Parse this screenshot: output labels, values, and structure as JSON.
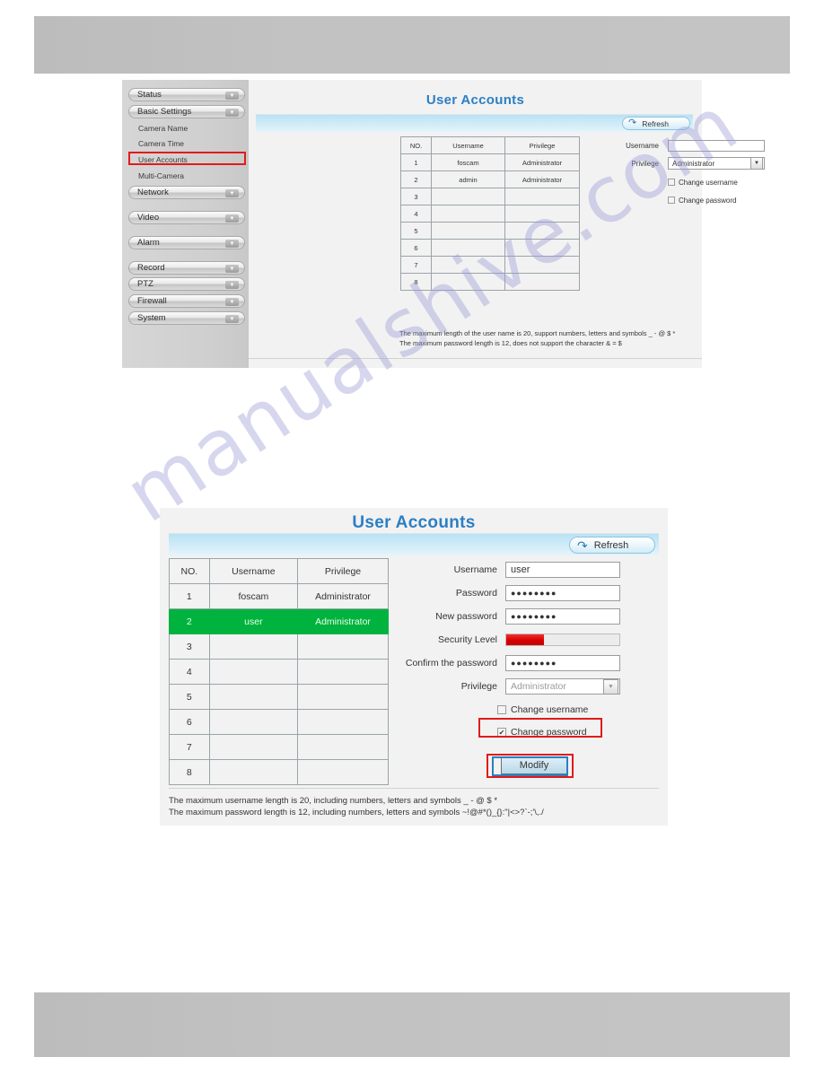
{
  "watermark": {
    "text": "manualshive.com"
  },
  "panel1": {
    "title": "User Accounts",
    "refresh_label": "Refresh",
    "refresh_icon": "refresh-arrow-icon",
    "sidebar": {
      "groups": [
        {
          "label": "Status",
          "icon": "chevron-down-icon"
        },
        {
          "label": "Basic Settings",
          "icon": "chevron-down-icon"
        },
        {
          "label": "Network",
          "icon": "chevron-down-icon"
        },
        {
          "label": "Video",
          "icon": "chevron-down-icon"
        },
        {
          "label": "Alarm",
          "icon": "chevron-down-icon"
        },
        {
          "label": "Record",
          "icon": "chevron-down-icon"
        },
        {
          "label": "PTZ",
          "icon": "chevron-down-icon"
        },
        {
          "label": "Firewall",
          "icon": "chevron-down-icon"
        },
        {
          "label": "System",
          "icon": "chevron-down-icon"
        }
      ],
      "sub_items": [
        {
          "label": "Camera Name"
        },
        {
          "label": "Camera Time"
        },
        {
          "label": "User Accounts"
        },
        {
          "label": "Multi-Camera"
        }
      ]
    },
    "table": {
      "headers": [
        "NO.",
        "Username",
        "Privilege"
      ],
      "rows": [
        {
          "no": "1",
          "username": "foscam",
          "privilege": "Administrator"
        },
        {
          "no": "2",
          "username": "admin",
          "privilege": "Administrator"
        },
        {
          "no": "3",
          "username": "",
          "privilege": ""
        },
        {
          "no": "4",
          "username": "",
          "privilege": ""
        },
        {
          "no": "5",
          "username": "",
          "privilege": ""
        },
        {
          "no": "6",
          "username": "",
          "privilege": ""
        },
        {
          "no": "7",
          "username": "",
          "privilege": ""
        },
        {
          "no": "8",
          "username": "",
          "privilege": ""
        }
      ]
    },
    "form": {
      "username_label": "Username",
      "username_value": "",
      "privilege_label": "Privilege",
      "privilege_value": "Administrator",
      "change_username_label": "Change username",
      "change_username_checked": false,
      "change_password_label": "Change password",
      "change_password_checked": false
    },
    "hints": [
      "The maximum length of the user name is 20, support numbers, letters and symbols _ - @ $ *",
      "The maximum password length is 12, does not support the character & = $"
    ]
  },
  "panel2": {
    "title": "User Accounts",
    "refresh_label": "Refresh",
    "refresh_icon": "refresh-arrow-icon",
    "table": {
      "headers": [
        "NO.",
        "Username",
        "Privilege"
      ],
      "rows": [
        {
          "no": "1",
          "username": "foscam",
          "privilege": "Administrator",
          "selected": false
        },
        {
          "no": "2",
          "username": "user",
          "privilege": "Administrator",
          "selected": true
        },
        {
          "no": "3",
          "username": "",
          "privilege": "",
          "selected": false
        },
        {
          "no": "4",
          "username": "",
          "privilege": "",
          "selected": false
        },
        {
          "no": "5",
          "username": "",
          "privilege": "",
          "selected": false
        },
        {
          "no": "6",
          "username": "",
          "privilege": "",
          "selected": false
        },
        {
          "no": "7",
          "username": "",
          "privilege": "",
          "selected": false
        },
        {
          "no": "8",
          "username": "",
          "privilege": "",
          "selected": false
        }
      ]
    },
    "form": {
      "username_label": "Username",
      "username_value": "user",
      "password_label": "Password",
      "password_value": "●●●●●●●●",
      "new_password_label": "New password",
      "new_password_value": "●●●●●●●●",
      "security_level_label": "Security Level",
      "security_level_percent": 33,
      "security_level_color": "#d80000",
      "confirm_password_label": "Confirm the password",
      "confirm_password_value": "●●●●●●●●",
      "privilege_label": "Privilege",
      "privilege_value": "Administrator",
      "change_username_label": "Change username",
      "change_username_checked": false,
      "change_password_label": "Change password",
      "change_password_checked": true,
      "modify_label": "Modify"
    },
    "hints": [
      "The maximum username length is 20, including numbers, letters and symbols _ - @ $ *",
      "The maximum password length is 12, including numbers, letters and symbols ~!@#*()_{}:\"|<>?`-;'\\,./"
    ]
  }
}
